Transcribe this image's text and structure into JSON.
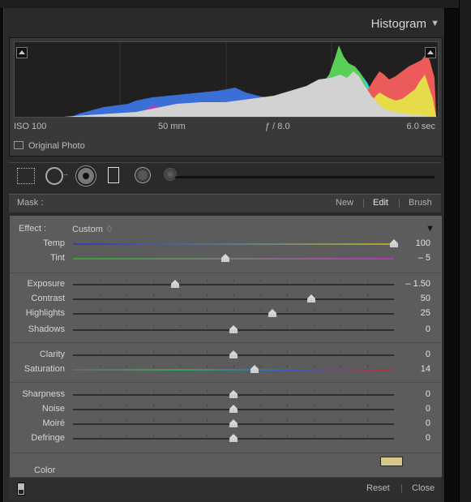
{
  "histogram": {
    "title": "Histogram",
    "iso": "ISO 100",
    "focal_length": "50 mm",
    "aperture": "ƒ / 8.0",
    "shutter": "6.0 sec",
    "original_photo_label": "Original Photo",
    "collapse_icon": "triangle-down-icon"
  },
  "toolbar": {
    "tools": [
      "crop-overlay-icon",
      "spot-removal-icon",
      "red-eye-icon",
      "graduated-filter-icon",
      "radial-filter-icon",
      "adjustment-brush-icon"
    ]
  },
  "mask": {
    "label": "Mask :",
    "new": "New",
    "edit": "Edit",
    "brush": "Brush",
    "active": "Edit"
  },
  "effect": {
    "label": "Effect :",
    "value": "Custom ♢"
  },
  "sliders": {
    "temp": {
      "label": "Temp",
      "value": "100",
      "pos": 1.0
    },
    "tint": {
      "label": "Tint",
      "value": "– 5",
      "pos": 0.475
    },
    "exposure": {
      "label": "Exposure",
      "value": "– 1.50",
      "pos": 0.318
    },
    "contrast": {
      "label": "Contrast",
      "value": "50",
      "pos": 0.742
    },
    "highlights": {
      "label": "Highlights",
      "value": "25",
      "pos": 0.622
    },
    "shadows": {
      "label": "Shadows",
      "value": "0",
      "pos": 0.5
    },
    "clarity": {
      "label": "Clarity",
      "value": "0",
      "pos": 0.5
    },
    "saturation": {
      "label": "Saturation",
      "value": "14",
      "pos": 0.566
    },
    "sharpness": {
      "label": "Sharpness",
      "value": "0",
      "pos": 0.5
    },
    "noise": {
      "label": "Noise",
      "value": "0",
      "pos": 0.5
    },
    "moire": {
      "label": "Moiré",
      "value": "0",
      "pos": 0.5
    },
    "defringe": {
      "label": "Defringe",
      "value": "0",
      "pos": 0.5
    }
  },
  "color": {
    "label": "Color",
    "swatch": "#d6c88a"
  },
  "footer": {
    "reset": "Reset",
    "close": "Close"
  }
}
